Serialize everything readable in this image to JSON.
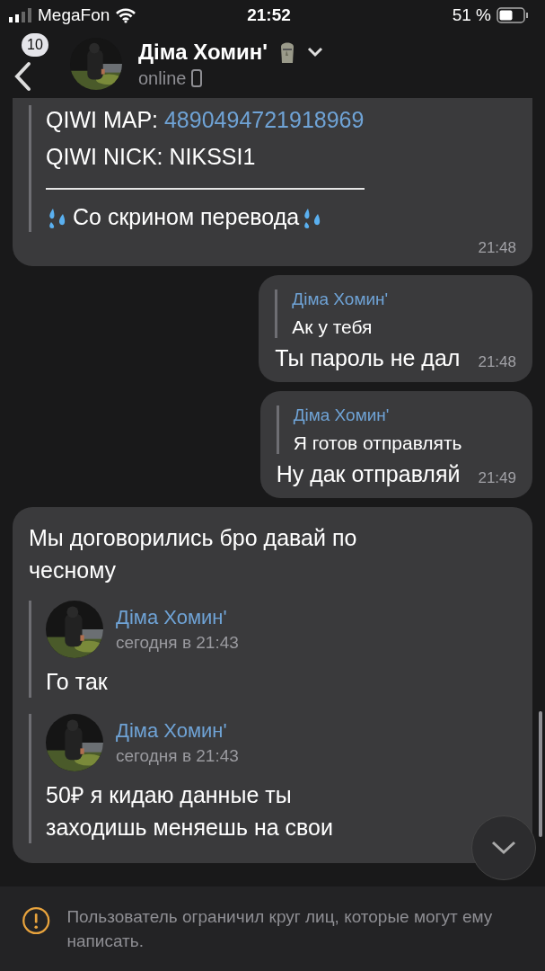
{
  "status_bar": {
    "carrier": "MegaFon",
    "time": "21:52",
    "battery": "51 %"
  },
  "header": {
    "back_badge": "10",
    "name": "Діма Хомин'",
    "status": "online"
  },
  "messages": [
    {
      "kind": "incoming",
      "cut_top": true,
      "forward_lines": [
        {
          "kind": "field",
          "label": "QIWI MAP:",
          "value": "4890494721918969",
          "is_link": true
        },
        {
          "kind": "field",
          "label": "QIWI NICK:",
          "value": "NIKSSI1",
          "is_link": false
        },
        {
          "kind": "rule"
        },
        {
          "kind": "decorated",
          "text": "Со скрином перевода"
        }
      ],
      "time": "21:48"
    },
    {
      "kind": "outgoing",
      "reply": {
        "name": "Діма Хомин'",
        "text": "Ак у тебя"
      },
      "text": "Ты пароль не дал",
      "time": "21:48"
    },
    {
      "kind": "outgoing",
      "reply": {
        "name": "Діма Хомин'",
        "text": "Я готов отправлять"
      },
      "text": "Ну дак отправляй",
      "time": "21:49"
    },
    {
      "kind": "incoming",
      "text": "Мы договорились бро давай по чесному",
      "forwards": [
        {
          "name": "Діма Хомин'",
          "date": "сегодня в 21:43",
          "text": "Го так"
        },
        {
          "name": "Діма Хомин'",
          "date": "сегодня в 21:43",
          "text": "50₽ я кидаю данные ты заходишь меняешь на свои"
        }
      ]
    }
  ],
  "notice": "Пользователь ограничил круг лиц, которые могут ему написать."
}
